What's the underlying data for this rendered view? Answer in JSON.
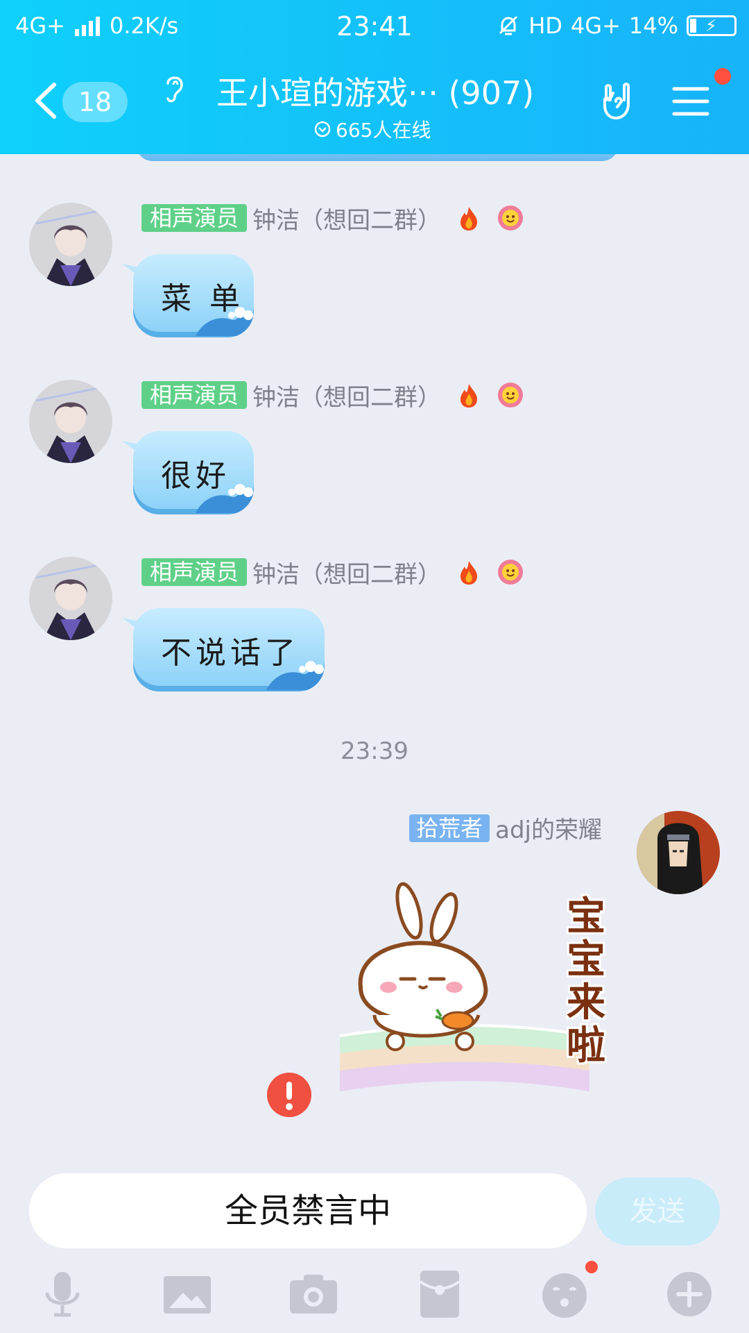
{
  "status_bar": {
    "network_left": "4G+",
    "speed": "0.2K/s",
    "time": "23:41",
    "hd": "HD",
    "network_right": "4G+",
    "battery": "14%"
  },
  "header": {
    "unread_count": "18",
    "title": "王小瑄的游戏··· (907)",
    "online": "665人在线"
  },
  "messages": [
    {
      "role": "相声演员",
      "name": "钟洁（想回二群）",
      "text": "菜 单"
    },
    {
      "role": "相声演员",
      "name": "钟洁（想回二群）",
      "text": "很好"
    },
    {
      "role": "相声演员",
      "name": "钟洁（想回二群）",
      "text": "不说话了"
    }
  ],
  "timestamp": "23:39",
  "my_message": {
    "role": "拾荒者",
    "name": "adj的荣耀",
    "sticker_text": "宝宝来啦"
  },
  "input": {
    "placeholder": "全员禁言中",
    "send_label": "发送"
  },
  "colors": {
    "header_start": "#0fd0fb",
    "header_end": "#17b3f9",
    "background": "#ebedf5",
    "role_tag": "#5fd088",
    "my_tag": "#79b3f2",
    "badge_red": "#ff4f3f"
  },
  "icons": [
    "back-icon",
    "ear-icon",
    "rock-hand-icon",
    "menu-icon",
    "fire-icon",
    "flower-icon",
    "error-icon",
    "mic-icon",
    "image-icon",
    "camera-icon",
    "red-packet-icon",
    "emoji-icon",
    "plus-icon"
  ]
}
